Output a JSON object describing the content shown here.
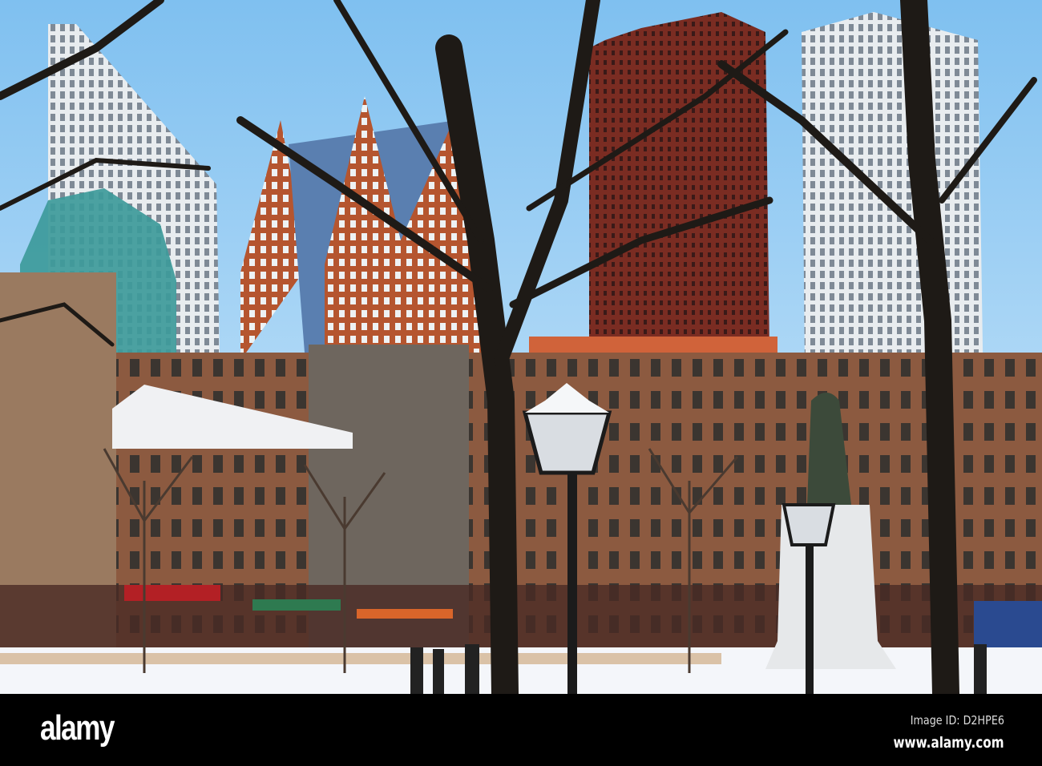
{
  "photo": {
    "subject": "snowy square"
  },
  "watermark": {
    "logo": "alamy",
    "image_id": "Image ID: D2HPE6",
    "url": "www.alamy.com"
  },
  "colors": {
    "sky": "#a9d6f7",
    "snow": "#f4f6fa",
    "brick": "#a0462e",
    "tower": "#7a2c22"
  }
}
